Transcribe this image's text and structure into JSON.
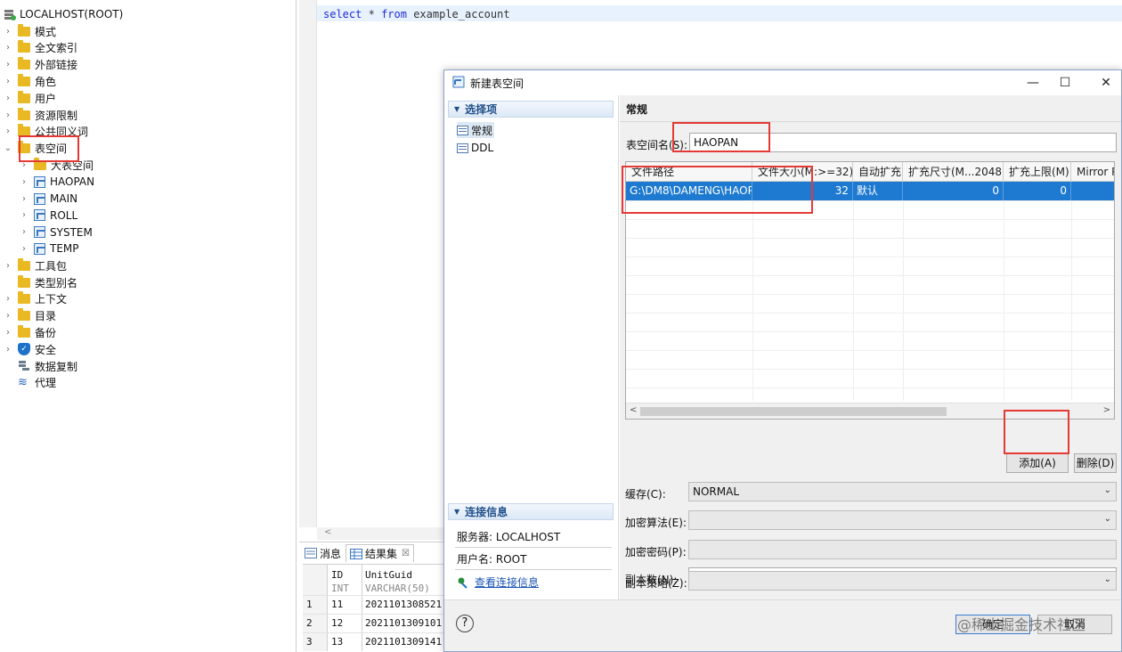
{
  "tree": {
    "root": "LOCALHOST(ROOT)",
    "items": [
      {
        "label": "模式",
        "icon": "folder-icon",
        "expand": true
      },
      {
        "label": "全文索引",
        "icon": "folder-icon",
        "expand": true
      },
      {
        "label": "外部链接",
        "icon": "folder-icon",
        "expand": true
      },
      {
        "label": "角色",
        "icon": "folder-icon",
        "expand": true
      },
      {
        "label": "用户",
        "icon": "folder-icon",
        "expand": true
      },
      {
        "label": "资源限制",
        "icon": "folder-icon",
        "expand": true
      },
      {
        "label": "公共同义词",
        "icon": "folder-icon",
        "expand": true
      },
      {
        "label": "表空间",
        "icon": "folder-icon",
        "expand": true,
        "open": true
      },
      {
        "label": "大表空间",
        "icon": "folder-icon",
        "expand": true,
        "child": true
      },
      {
        "label": "HAOPAN",
        "icon": "tablespace-icon",
        "expand": true,
        "child": true
      },
      {
        "label": "MAIN",
        "icon": "tablespace-icon",
        "expand": true,
        "child": true
      },
      {
        "label": "ROLL",
        "icon": "tablespace-icon",
        "expand": true,
        "child": true
      },
      {
        "label": "SYSTEM",
        "icon": "tablespace-icon",
        "expand": true,
        "child": true
      },
      {
        "label": "TEMP",
        "icon": "tablespace-icon",
        "expand": true,
        "child": true
      },
      {
        "label": "工具包",
        "icon": "folder-icon",
        "expand": true
      },
      {
        "label": "类型别名",
        "icon": "folder-icon",
        "expand": false
      },
      {
        "label": "上下文",
        "icon": "folder-icon",
        "expand": true
      },
      {
        "label": "目录",
        "icon": "folder-icon",
        "expand": true
      },
      {
        "label": "备份",
        "icon": "folder-icon",
        "expand": true
      },
      {
        "label": "安全",
        "icon": "shield-icon",
        "expand": true
      },
      {
        "label": "数据复制",
        "icon": "replication-icon",
        "expand": false
      },
      {
        "label": "代理",
        "icon": "agent-icon",
        "expand": false
      }
    ]
  },
  "editor": {
    "kw1": "select",
    "mid": "*",
    "kw2": "from",
    "rest": "example_account",
    "scroll_glyph": "<"
  },
  "results": {
    "tab_messages": "消息",
    "tab_resultset": "结果集",
    "tab_close": "☒",
    "col_id": "ID",
    "col_id_type": "INT",
    "col_guid": "UnitGuid",
    "col_guid_type": "VARCHAR(50)",
    "rows": [
      {
        "n": "1",
        "id": "11",
        "guid": "2021101308521"
      },
      {
        "n": "2",
        "id": "12",
        "guid": "2021101309101"
      },
      {
        "n": "3",
        "id": "13",
        "guid": "2021101309141"
      }
    ]
  },
  "dialog": {
    "title": "新建表空间",
    "minimize": "—",
    "maximize": "☐",
    "close": "✕",
    "options_header": "选择项",
    "nav_general": "常规",
    "nav_ddl": "DDL",
    "conn_header": "连接信息",
    "server_label": "服务器: LOCALHOST",
    "user_label": "用户名: ROOT",
    "view_conn": "查看连接信息",
    "help": "?",
    "section_title": "常规",
    "name_label": "表空间名(S):",
    "name_value": "HAOPAN",
    "columns": [
      "文件路径",
      "文件大小(M:>=32)",
      "自动扩充",
      "扩充尺寸(M...2048)",
      "扩充上限(M)",
      "Mirror P"
    ],
    "file_row": {
      "path": "G:\\DM8\\DAMENG\\HAOP",
      "size": "32",
      "auto": "默认",
      "ext": "0",
      "limit": "0",
      "mirror": ""
    },
    "add_button": "添加(A)",
    "delete_button": "删除(D)",
    "cache_label": "缓存(C):",
    "cache_value": "NORMAL",
    "crypt_algo_label": "加密算法(E):",
    "crypt_pwd_label": "加密密码(P):",
    "copies_label": "副本数(N):",
    "copy_policy_label": "副本策略(Z):",
    "ok_button": "确定",
    "cancel_button": "取消",
    "watermark": "@稀土掘金技术社区"
  },
  "colors": {
    "accent": "#1e7ad0",
    "highlight_box": "#e53935",
    "folder": "#e8b923"
  }
}
